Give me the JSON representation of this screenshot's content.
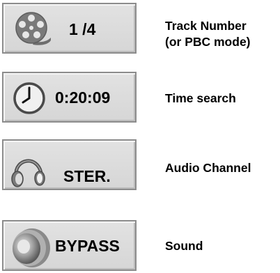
{
  "rows": [
    {
      "icon": "disc-reel-icon",
      "value": "1 /4",
      "label_line1": "Track Number",
      "label_line2": "(or PBC mode)"
    },
    {
      "icon": "clock-icon",
      "value": "0:20:09",
      "label_line1": "Time search"
    },
    {
      "icon": "headphones-icon",
      "value": "STER.",
      "label_line1": "Audio Channel"
    },
    {
      "icon": "speaker-icon",
      "value": "BYPASS",
      "label_line1": "Sound"
    }
  ],
  "colors": {
    "panel_background": "#d9d9d9",
    "panel_border": "#8c8c8c",
    "icon_gray": "#7a7a7a"
  }
}
